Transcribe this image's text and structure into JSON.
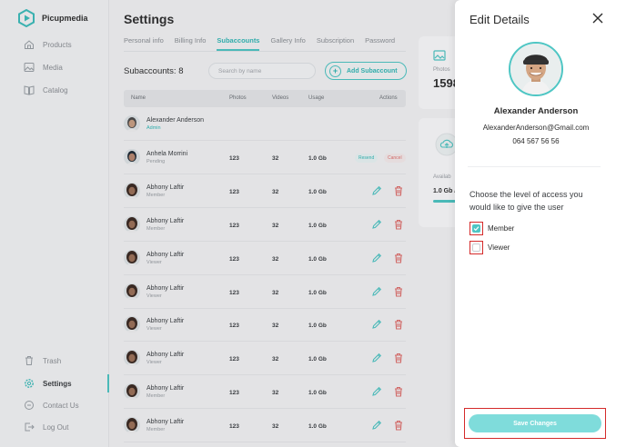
{
  "brand": {
    "name": "Picupmedia"
  },
  "sidebar": {
    "items": [
      {
        "label": "Products",
        "icon": "home-icon"
      },
      {
        "label": "Media",
        "icon": "image-icon"
      },
      {
        "label": "Catalog",
        "icon": "book-icon"
      }
    ],
    "bottom_items": [
      {
        "label": "Trash",
        "icon": "trash-icon"
      },
      {
        "label": "Settings",
        "icon": "gear-icon",
        "active": true
      },
      {
        "label": "Contact Us",
        "icon": "chat-icon"
      },
      {
        "label": "Log Out",
        "icon": "logout-icon"
      }
    ]
  },
  "main": {
    "title": "Settings",
    "tabs": [
      "Personal info",
      "Billing Info",
      "Subaccounts",
      "Gallery Info",
      "Subscription",
      "Password"
    ],
    "active_tab": "Subaccounts",
    "subaccounts_label": "Subaccounts: 8",
    "search_placeholder": "Search by name",
    "add_button": "Add Subaccount",
    "columns": [
      "Name",
      "Photos",
      "Videos",
      "Usage",
      "Actions"
    ],
    "rows": [
      {
        "name": "Alexander Anderson",
        "role": "Admin",
        "photos": "",
        "videos": "",
        "usage": ""
      },
      {
        "name": "Anhela Morrini",
        "role": "Pending",
        "photos": "123",
        "videos": "32",
        "usage": "1.0 Gb",
        "resend": "Resend",
        "cancel": "Cancel"
      },
      {
        "name": "Abhony Laftir",
        "role": "Member",
        "photos": "123",
        "videos": "32",
        "usage": "1.0 Gb"
      },
      {
        "name": "Abhony Laftir",
        "role": "Member",
        "photos": "123",
        "videos": "32",
        "usage": "1.0 Gb"
      },
      {
        "name": "Abhony Laftir",
        "role": "Viewer",
        "photos": "123",
        "videos": "32",
        "usage": "1.0 Gb"
      },
      {
        "name": "Abhony Laftir",
        "role": "Viewer",
        "photos": "123",
        "videos": "32",
        "usage": "1.0 Gb"
      },
      {
        "name": "Abhony Laftir",
        "role": "Viewer",
        "photos": "123",
        "videos": "32",
        "usage": "1.0 Gb"
      },
      {
        "name": "Abhony Laftir",
        "role": "Viewer",
        "photos": "123",
        "videos": "32",
        "usage": "1.0 Gb"
      },
      {
        "name": "Abhony Laftir",
        "role": "Member",
        "photos": "123",
        "videos": "32",
        "usage": "1.0 Gb"
      },
      {
        "name": "Abhony Laftir",
        "role": "Member",
        "photos": "123",
        "videos": "32",
        "usage": "1.0 Gb"
      }
    ],
    "stats": {
      "photos_label": "Photos",
      "photos_value": "1598",
      "available_label": "Availab",
      "available_value": "1.0 Gb /"
    }
  },
  "panel": {
    "title": "Edit Details",
    "name": "Alexander Anderson",
    "email": "AlexanderAnderson@Gmail.com",
    "phone": "064 567 56 56",
    "prompt": "Choose the level of access you would like to give the user",
    "options": [
      {
        "label": "Member",
        "checked": true
      },
      {
        "label": "Viewer",
        "checked": false
      }
    ],
    "save_label": "Save Changes"
  },
  "colors": {
    "accent": "#4ec6c4",
    "danger": "#e0706d",
    "highlight": "#d42a2a"
  }
}
